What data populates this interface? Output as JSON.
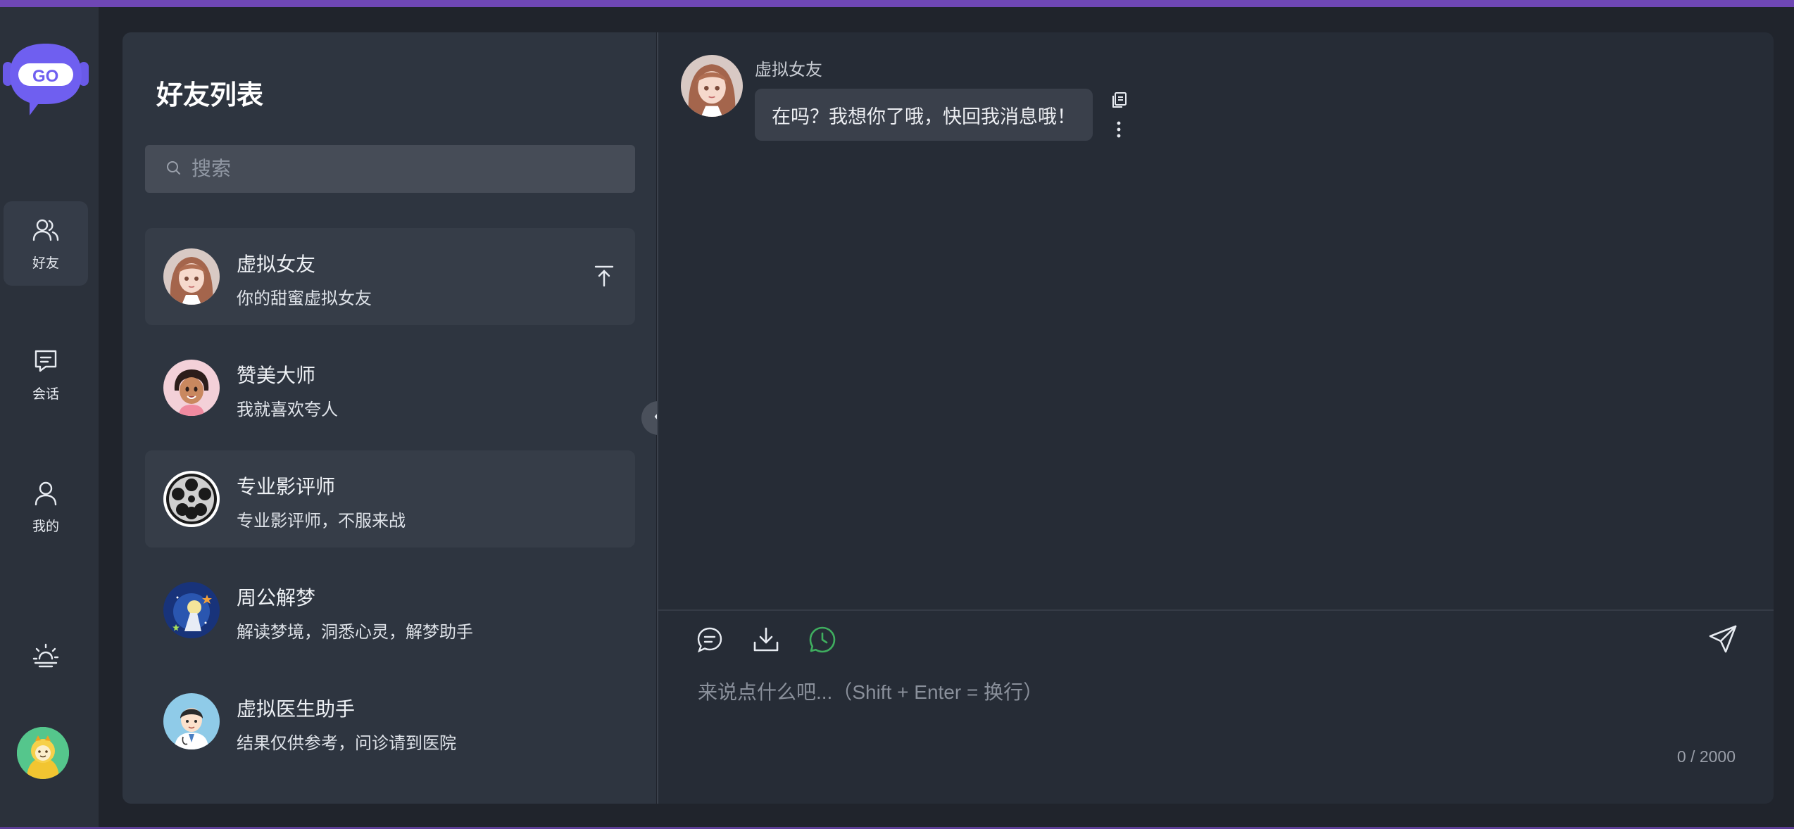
{
  "nav": {
    "friends_label": "好友",
    "sessions_label": "会话",
    "me_label": "我的",
    "logo_text": "GO",
    "active_color": "#353c48"
  },
  "friends_panel": {
    "title": "好友列表",
    "search_placeholder": "搜索",
    "items": [
      {
        "name": "虚拟女友",
        "desc": "你的甜蜜虚拟女友",
        "avatar": "anime-girl-avatar",
        "pinned": true
      },
      {
        "name": "赞美大师",
        "desc": "我就喜欢夸人",
        "avatar": "cartoon-girl-avatar"
      },
      {
        "name": "专业影评师",
        "desc": "专业影评师，不服来战",
        "avatar": "film-reel-avatar"
      },
      {
        "name": "周公解梦",
        "desc": "解读梦境，洞悉心灵，解梦助手",
        "avatar": "dream-night-avatar"
      },
      {
        "name": "虚拟医生助手",
        "desc": "结果仅供参考，问诊请到医院",
        "avatar": "doctor-avatar"
      }
    ]
  },
  "chat": {
    "message": {
      "sender": "虚拟女友",
      "text": "在吗？我想你了哦，快回我消息哦！"
    },
    "input_placeholder": "来说点什么吧...（Shift + Enter = 换行）",
    "counter": "0 / 2000",
    "accent_green": "#3fae5f"
  }
}
